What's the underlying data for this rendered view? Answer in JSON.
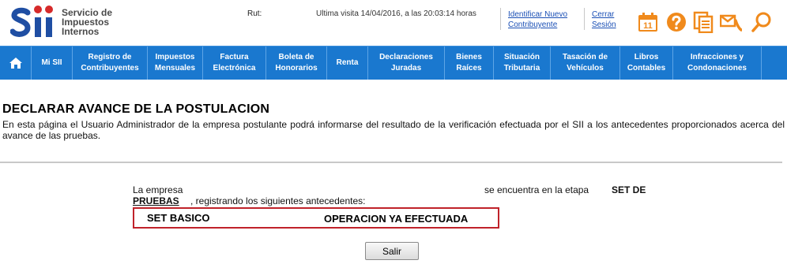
{
  "header": {
    "logo_lines": [
      "Servicio de",
      "Impuestos",
      "Internos"
    ],
    "rut_label": "Rut:",
    "last_visit": "Ultima visita 14/04/2016, a las 20:03:14 horas",
    "identify_link": [
      "Identificar Nuevo",
      "Contribuyente"
    ],
    "logout_link": [
      "Cerrar",
      "Sesión"
    ],
    "calendar_day": "11",
    "icons": [
      "calendar-icon",
      "help-icon",
      "documents-icon",
      "contact-icon",
      "search-icon"
    ],
    "icon_color": "#f08a1c"
  },
  "nav": {
    "items": [
      [
        "Mi SII"
      ],
      [
        "Registro de",
        "Contribuyentes"
      ],
      [
        "Impuestos",
        "Mensuales"
      ],
      [
        "Factura",
        "Electrónica"
      ],
      [
        "Boleta de",
        "Honorarios"
      ],
      [
        "Renta"
      ],
      [
        "Declaraciones",
        "Juradas"
      ],
      [
        "Bienes",
        "Raíces"
      ],
      [
        "Situación",
        "Tributaria"
      ],
      [
        "Tasación de",
        "Vehículos"
      ],
      [
        "Libros",
        "Contables"
      ],
      [
        "Infracciones y",
        "Condonaciones"
      ]
    ],
    "bg_color": "#1a78cf"
  },
  "main": {
    "title": "DECLARAR AVANCE DE LA POSTULACION",
    "intro": "En esta página el Usuario Administrador de la empresa postulante podrá informarse del resultado de la verificación efectuada por el SII a los antecedentes proporcionados acerca del avance de las pruebas.",
    "status_text_1": "La empresa",
    "status_text_2": "se encuentra en la etapa",
    "stage_name_1": "SET DE",
    "stage_name_2": "PRUEBAS",
    "status_text_3": ", registrando los siguientes antecedentes:",
    "result": {
      "set": "SET BASICO",
      "status": "OPERACION YA EFECTUADA"
    },
    "result_border_color": "#c0222a",
    "exit_button": "Salir"
  }
}
